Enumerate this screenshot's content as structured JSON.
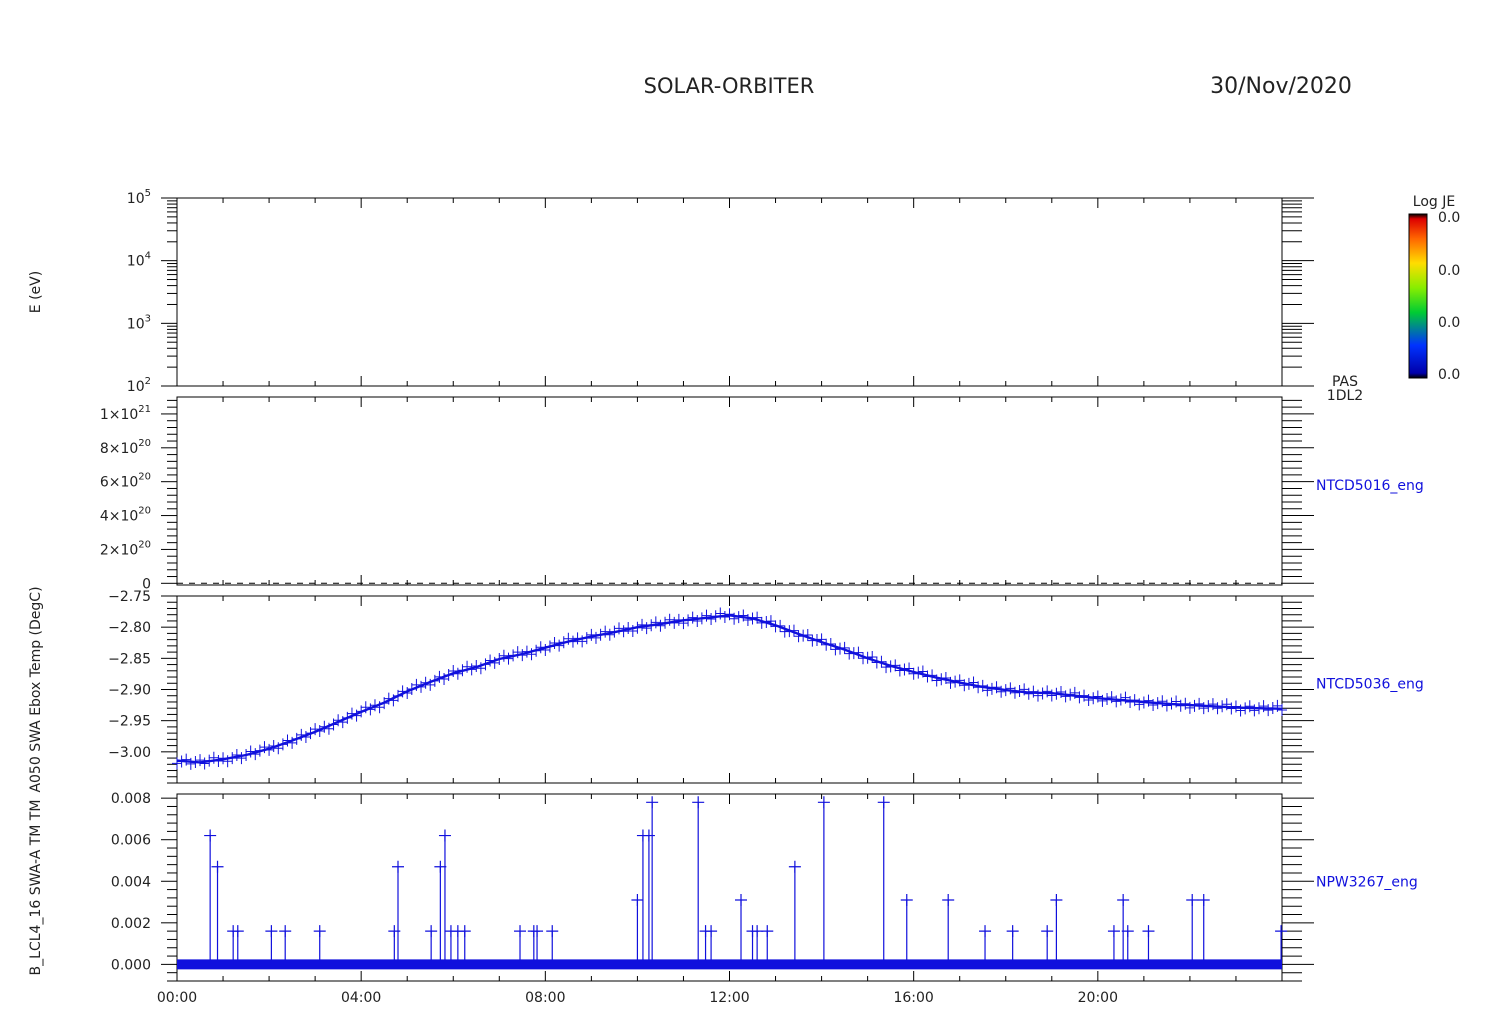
{
  "header": {
    "mission": "SOLAR-ORBITER",
    "date": "30/Nov/2020"
  },
  "colors": {
    "trace": "#1010dd",
    "axis": "#000000"
  },
  "colorbar": {
    "title": "Log JE",
    "tick_labels": [
      "0.0",
      "0.0",
      "0.0",
      "0.0"
    ]
  },
  "chart_data": [
    {
      "type": "heatmap",
      "name_label": "",
      "ylabel": "E (eV)",
      "yscale": "log",
      "ylim": [
        100,
        100000
      ],
      "ytick_values": [
        100,
        1000,
        10000,
        100000
      ],
      "ytick_labels": [
        {
          "base": "10",
          "exp": "2"
        },
        {
          "base": "10",
          "exp": "3"
        },
        {
          "base": "10",
          "exp": "4"
        },
        {
          "base": "10",
          "exp": "5"
        }
      ],
      "right_label": [
        "PAS",
        "1DL2"
      ],
      "values": []
    },
    {
      "type": "line",
      "ylabel": "",
      "ylim": [
        -1e+19,
        1.1e+21
      ],
      "ytick_values": [
        0,
        2e+20,
        4e+20,
        6e+20,
        8e+20,
        1e+21
      ],
      "ytick_labels": [
        {
          "base": "0",
          "exp": ""
        },
        {
          "base": "2×10",
          "exp": "20"
        },
        {
          "base": "4×10",
          "exp": "20"
        },
        {
          "base": "6×10",
          "exp": "20"
        },
        {
          "base": "8×10",
          "exp": "20"
        },
        {
          "base": "1×10",
          "exp": "21"
        }
      ],
      "right_label": [
        "NTCD5016_eng"
      ],
      "series": [
        {
          "values_at_hours": [
            0,
            24
          ],
          "values": [
            0,
            0
          ],
          "style": "dashed"
        }
      ]
    },
    {
      "type": "line",
      "ylabel": "A050 SWA Ebox Temp (DegC)",
      "ylim": [
        -3.05,
        -2.75
      ],
      "ytick_values": [
        -3.0,
        -2.95,
        -2.9,
        -2.85,
        -2.8,
        -2.75
      ],
      "ytick_labels": [
        {
          "base": "−3.00",
          "exp": ""
        },
        {
          "base": "−2.95",
          "exp": ""
        },
        {
          "base": "−2.90",
          "exp": ""
        },
        {
          "base": "−2.85",
          "exp": ""
        },
        {
          "base": "−2.80",
          "exp": ""
        },
        {
          "base": "−2.75",
          "exp": ""
        }
      ],
      "right_label": [
        "NTCD5036_eng"
      ],
      "series": [
        {
          "x_hours": [
            0,
            0.5,
            1,
            1.5,
            2,
            2.5,
            3,
            3.5,
            4,
            4.5,
            5,
            5.5,
            6,
            6.5,
            7,
            7.5,
            8,
            8.5,
            9,
            9.5,
            10,
            10.5,
            11,
            11.5,
            12,
            12.5,
            13,
            13.5,
            14,
            14.5,
            15,
            15.5,
            16,
            16.5,
            17,
            17.5,
            18,
            18.5,
            19,
            19.5,
            20,
            20.5,
            21,
            21.5,
            22,
            22.5,
            23,
            23.5,
            24
          ],
          "values": [
            -3.014,
            -3.017,
            -3.012,
            -3.005,
            -2.995,
            -2.982,
            -2.968,
            -2.952,
            -2.936,
            -2.921,
            -2.903,
            -2.888,
            -2.874,
            -2.864,
            -2.851,
            -2.843,
            -2.833,
            -2.823,
            -2.815,
            -2.808,
            -2.8,
            -2.795,
            -2.789,
            -2.785,
            -2.781,
            -2.786,
            -2.797,
            -2.811,
            -2.824,
            -2.836,
            -2.85,
            -2.862,
            -2.872,
            -2.881,
            -2.889,
            -2.896,
            -2.901,
            -2.905,
            -2.906,
            -2.91,
            -2.914,
            -2.917,
            -2.92,
            -2.923,
            -2.925,
            -2.927,
            -2.929,
            -2.93,
            -2.931
          ]
        }
      ]
    },
    {
      "type": "line",
      "ylabel": "B_LCL4_16 SWA-A TM TM",
      "ylim": [
        -0.0008,
        0.0082
      ],
      "ytick_values": [
        0.0,
        0.002,
        0.004,
        0.006,
        0.008
      ],
      "ytick_labels": [
        {
          "base": "0.000",
          "exp": ""
        },
        {
          "base": "0.002",
          "exp": ""
        },
        {
          "base": "0.004",
          "exp": ""
        },
        {
          "base": "0.006",
          "exp": ""
        },
        {
          "base": "0.008",
          "exp": ""
        }
      ],
      "right_label": [
        "NPW3267_eng"
      ],
      "baseline_band": [
        -0.00024,
        0.00024
      ],
      "series": [
        {
          "spike_hours": [
            0.72,
            0.88,
            1.22,
            1.32,
            2.05,
            2.35,
            3.1,
            4.72,
            4.8,
            5.52,
            5.72,
            5.82,
            5.95,
            6.1,
            6.25,
            7.45,
            7.75,
            7.82,
            8.15,
            10.0,
            10.12,
            10.25,
            10.32,
            11.32,
            11.48,
            11.6,
            12.25,
            12.5,
            12.6,
            12.82,
            13.42,
            14.05,
            15.35,
            15.85,
            16.75,
            17.55,
            18.15,
            18.9,
            19.1,
            20.35,
            20.55,
            20.65,
            21.1,
            22.05,
            22.3,
            23.98
          ],
          "spike_values": [
            0.0062,
            0.0047,
            0.0016,
            0.0016,
            0.0016,
            0.0016,
            0.0016,
            0.0016,
            0.0047,
            0.0016,
            0.0047,
            0.0062,
            0.0016,
            0.0016,
            0.0016,
            0.0016,
            0.0016,
            0.0016,
            0.0016,
            0.0031,
            0.0062,
            0.0062,
            0.0078,
            0.0078,
            0.0016,
            0.0016,
            0.0031,
            0.0016,
            0.0016,
            0.0016,
            0.0047,
            0.0078,
            0.0078,
            0.0031,
            0.0031,
            0.0016,
            0.0016,
            0.0016,
            0.0031,
            0.0016,
            0.0031,
            0.0016,
            0.0016,
            0.0031,
            0.0031,
            0.0016
          ]
        }
      ]
    }
  ],
  "x_axis": {
    "range_hours": [
      0,
      24
    ],
    "major_tick_hours": [
      0,
      4,
      8,
      12,
      16,
      20
    ],
    "major_tick_labels": [
      "00:00",
      "04:00",
      "08:00",
      "12:00",
      "16:00",
      "20:00"
    ]
  }
}
